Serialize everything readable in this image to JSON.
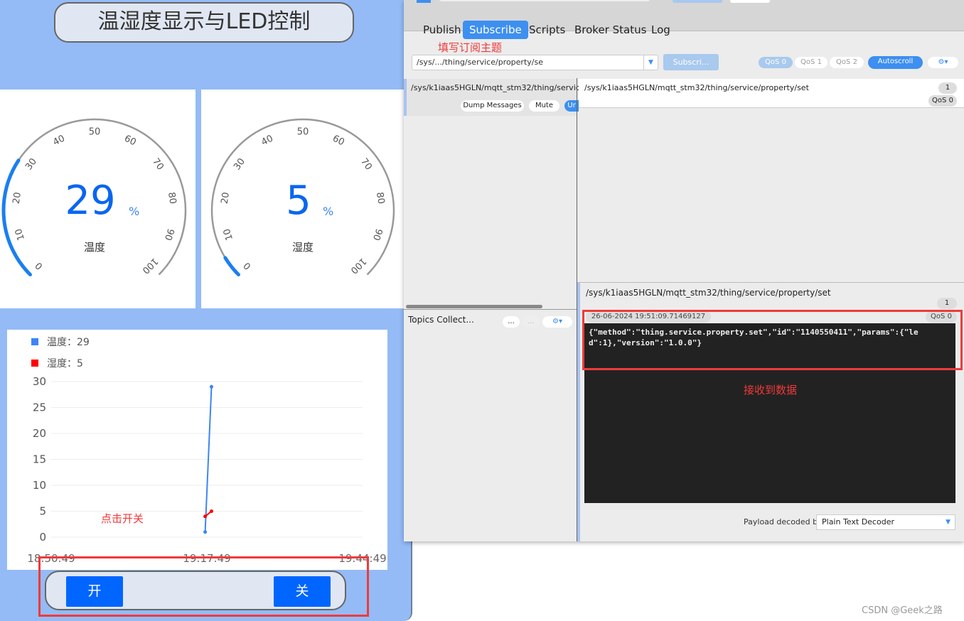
{
  "dashboard": {
    "title": "温湿度显示与LED控制",
    "gauges": [
      {
        "value": 29,
        "unit": "%",
        "label": "温度",
        "min": 0,
        "max": 100,
        "ticks": [
          0,
          10,
          20,
          30,
          40,
          50,
          60,
          70,
          80,
          90,
          100
        ]
      },
      {
        "value": 5,
        "unit": "%",
        "label": "湿度",
        "min": 0,
        "max": 100,
        "ticks": [
          0,
          10,
          20,
          30,
          40,
          50,
          60,
          70,
          80,
          90,
          100
        ]
      }
    ],
    "buttons": {
      "on": "开",
      "off": "关"
    },
    "annotation_click": "点击开关"
  },
  "chart_data": {
    "type": "line",
    "legend": [
      {
        "label": "温度：29",
        "color": "#3d85f5"
      },
      {
        "label": "湿度：5",
        "color": "#ff0000"
      }
    ],
    "ylim": [
      0,
      30
    ],
    "yticks": [
      "0",
      "5",
      "10",
      "15",
      "20",
      "25",
      "30"
    ],
    "xticks": [
      "18:50:49",
      "19:17:49",
      "19:44:49"
    ],
    "grid": true,
    "series": [
      {
        "color": "#3d85f5",
        "points": [
          [
            "19:17:31",
            1
          ],
          [
            "19:18:37",
            29
          ]
        ]
      },
      {
        "color": "#ff0000",
        "points": [
          [
            "19:17:31",
            4
          ],
          [
            "19:18:37",
            5
          ]
        ]
      }
    ]
  },
  "mqtt": {
    "tabs": [
      "Publish",
      "Subscribe",
      "Scripts",
      "Broker Status",
      "Log"
    ],
    "active_tab": "Subscribe",
    "annotation_topic": "填写订阅主题",
    "topic_input": "/sys/.../thing/service/property/se",
    "subscribe_button": "Subscri...",
    "qos_buttons": [
      "QoS 0",
      "QoS 1",
      "QoS 2"
    ],
    "autoscroll": "Autoscroll",
    "subscription_topic": "/sys/k1iaas5HGLN/mqtt_stm32/thing/service/property/set",
    "dump_messages": "Dump Messages",
    "mute": "Mute",
    "unsub": "Ur",
    "topics_collector": "Topics Collect...",
    "collector_btn": "...",
    "message_list": {
      "topic": "/sys/k1iaas5HGLN/mqtt_stm32/thing/service/property/set",
      "count": "1",
      "qos": "QoS 0"
    },
    "detail": {
      "topic": "/sys/k1iaas5HGLN/mqtt_stm32/thing/service/property/set",
      "count": "1",
      "timestamp": "26-06-2024  19:51:09.71469127",
      "qos": "QoS 0",
      "payload_line1": "{\"method\":\"thing.service.property.set\",\"id\":\"1140550411\",\"params\":{\"le",
      "payload_line2": "d\":1},\"version\":\"1.0.0\"}"
    },
    "annotation_received": "接收到数据",
    "decoder_label": "Payload decoded by",
    "decoder_value": "Plain Text Decoder"
  },
  "watermark": "CSDN @Geek之路"
}
